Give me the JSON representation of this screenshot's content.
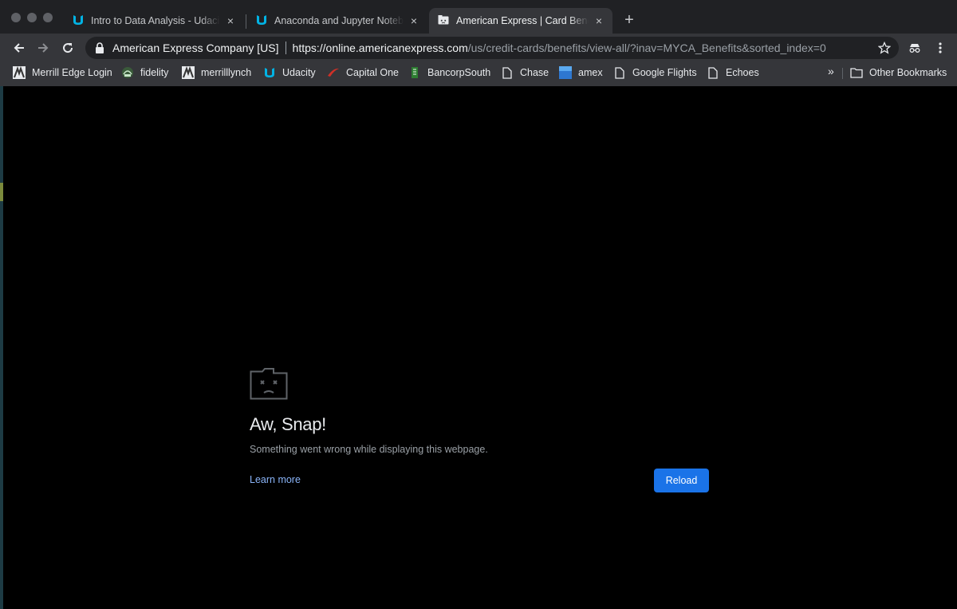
{
  "tabs": [
    {
      "title": "Intro to Data Analysis - Udacity",
      "close": "×"
    },
    {
      "title": "Anaconda and Jupyter Notebooks",
      "close": "×"
    },
    {
      "title": "American Express | Card Benefits",
      "close": "×"
    }
  ],
  "new_tab": "+",
  "toolbar": {
    "ev_cert": "American Express Company [US]",
    "url_host": "https://online.americanexpress.com",
    "url_path": "/us/credit-cards/benefits/view-all/?inav=MYCA_Benefits&sorted_index=0"
  },
  "bookmarks": [
    {
      "label": "Merrill Edge Login",
      "icon": "merrill-favicon"
    },
    {
      "label": "fidelity",
      "icon": "fidelity-favicon"
    },
    {
      "label": "merrilllynch",
      "icon": "merrill-favicon"
    },
    {
      "label": "Udacity",
      "icon": "udacity-favicon"
    },
    {
      "label": "Capital One",
      "icon": "capital-one-favicon"
    },
    {
      "label": "BancorpSouth",
      "icon": "bancorpsouth-favicon"
    },
    {
      "label": "Chase",
      "icon": "page-icon"
    },
    {
      "label": "amex",
      "icon": "amex-favicon"
    },
    {
      "label": "Google Flights",
      "icon": "page-icon"
    },
    {
      "label": "Echoes",
      "icon": "page-icon"
    }
  ],
  "overflow": "»",
  "other_bookmarks": "Other Bookmarks",
  "error": {
    "title": "Aw, Snap!",
    "message": "Something went wrong while displaying this webpage.",
    "learn_more": "Learn more",
    "reload": "Reload"
  },
  "colors": {
    "accent": "#1a73e8",
    "link": "#8ab4f8",
    "page_bg": "#000000",
    "chrome_bg": "#35363a"
  }
}
